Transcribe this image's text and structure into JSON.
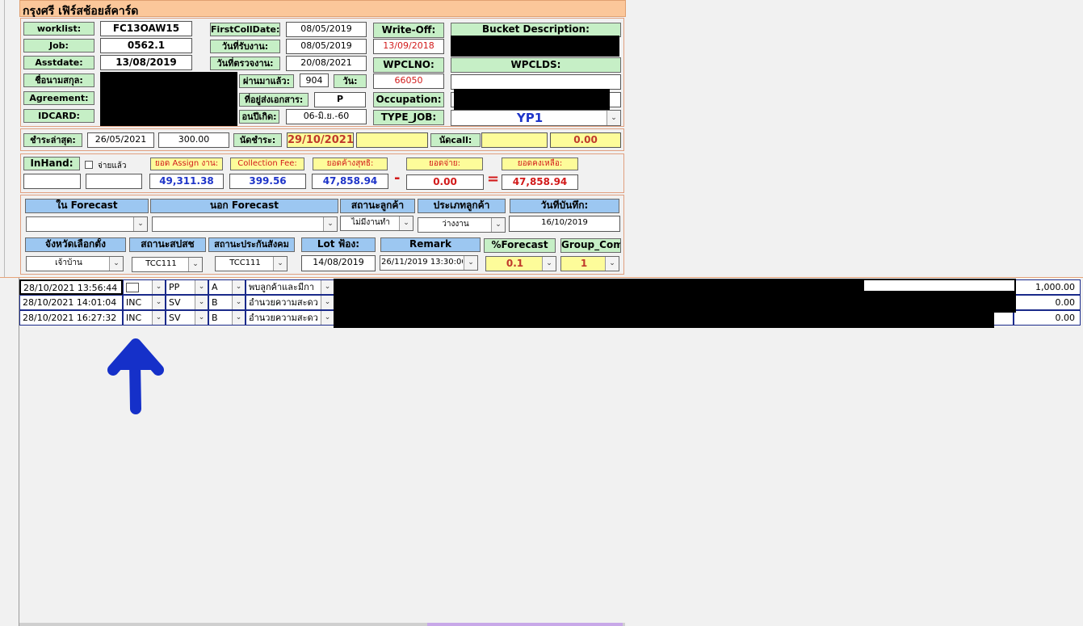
{
  "title": "กรุงศรี เฟิร์สช้อยส์คาร์ด",
  "colors": {
    "title_bar": "#fbc79a",
    "label_green": "#c6efc6",
    "label_blue": "#9cc7f1",
    "label_yellow": "#fdfc9a",
    "arrow": "#1530c9",
    "red_text": "#d21a1a",
    "blue_text": "#1f35c9"
  },
  "header": {
    "worklist_label": "worklist:",
    "worklist_value": "FC13OAW15",
    "job_label": "Job:",
    "job_value": "0562.1",
    "asstdate_label": "Asstdate:",
    "asstdate_value": "13/08/2019",
    "name_label": "ชื่อนามสกุล:",
    "agreement_label": "Agreement:",
    "idcard_label": "IDCARD:",
    "firstcolldate_label": "FirstCollDate:",
    "firstcolldate_value": "08/05/2019",
    "receive_label": "วันที่รับงาน:",
    "receive_value": "08/05/2019",
    "check_label": "วันที่ตรวจงาน:",
    "check_value": "20/08/2021",
    "passed_label": "ผ่านมาแล้ว:",
    "passed_value": "904",
    "day_label": "วัน:",
    "address_label": "ที่อยู่ส่งเอกสาร:",
    "address_value": "P",
    "birth_label": "อนปีเกิด:",
    "birth_value": "06-มิ.ย.-60",
    "writeoff_label": "Write-Off:",
    "writeoff_value": "13/09/2018",
    "wpclno_label": "WPCLNO:",
    "wpclno_value": "66050",
    "occupation_label": "Occupation:",
    "typejob_label": "TYPE_JOB:",
    "typejob_value": "YP1",
    "bucket_label": "Bucket Description:",
    "wpclds_label": "WPCLDS:"
  },
  "payment": {
    "last_label": "ชำระล่าสุด:",
    "last_date": "26/05/2021",
    "last_amount": "300.00",
    "appoint_label": "นัดชำระ:",
    "appoint_date": "29/10/2021",
    "call_label": "นัดcall:",
    "call_value": "0.00"
  },
  "summary": {
    "inhand_label": "InHand:",
    "paid_checkbox_label": "จ่ายแล้ว",
    "assign_label": "ยอด Assign งาน:",
    "assign_value": "49,311.38",
    "fee_label": "Collection Fee:",
    "fee_value": "399.56",
    "net_label": "ยอดค้างสุทธิ:",
    "net_value": "47,858.94",
    "minus": "-",
    "paid_label": "ยอดจ่าย:",
    "paid_value": "0.00",
    "equals": "=",
    "remain_label": "ยอดคงเหลือ:",
    "remain_value": "47,858.94"
  },
  "forecast": {
    "in_label": "ใน Forecast",
    "in_value": "",
    "out_label": "นอก Forecast",
    "out_value": "",
    "status_label": "สถานะลูกค้า",
    "status_value": "ไม่มีงานทำ",
    "type_label": "ประเภทลูกค้า",
    "type_value": "ว่างงาน",
    "record_label": "วันที่บันทึก:",
    "record_value": "16/10/2019",
    "province_label": "จังหวัดเลือกตั้ง",
    "province_value": "เจ้าบ้าน",
    "spsc_label": "สถานะสปสช",
    "spsc_value": "TCC111",
    "social_label": "สถานะประกันสังคม",
    "social_value": "TCC111",
    "lot_label": "Lot ฟ้อง:",
    "lot_value": "14/08/2019",
    "remark_label": "Remark",
    "remark_value": "26/11/2019 13:30:00",
    "pct_label": "%Forecast",
    "pct_value": "0.1",
    "group_label": "Group_Com",
    "group_value": "1"
  },
  "log_rows": [
    {
      "datetime": "28/10/2021 13:56:44",
      "code": "",
      "action": "PP",
      "grade": "A",
      "note": "พบลูกค้าและมีกา",
      "amount": "1,000.00"
    },
    {
      "datetime": "28/10/2021 14:01:04",
      "code": "INC",
      "action": "SV",
      "grade": "B",
      "note": "อำนวยความสะดว",
      "amount": "0.00"
    },
    {
      "datetime": "28/10/2021 16:27:32",
      "code": "INC",
      "action": "SV",
      "grade": "B",
      "note": "อำนวยความสะดว",
      "amount": "0.00"
    }
  ],
  "icons": {
    "dropdown": "chevron-down-icon",
    "calendar": "calendar-icon",
    "annotation": "up-arrow-icon"
  }
}
